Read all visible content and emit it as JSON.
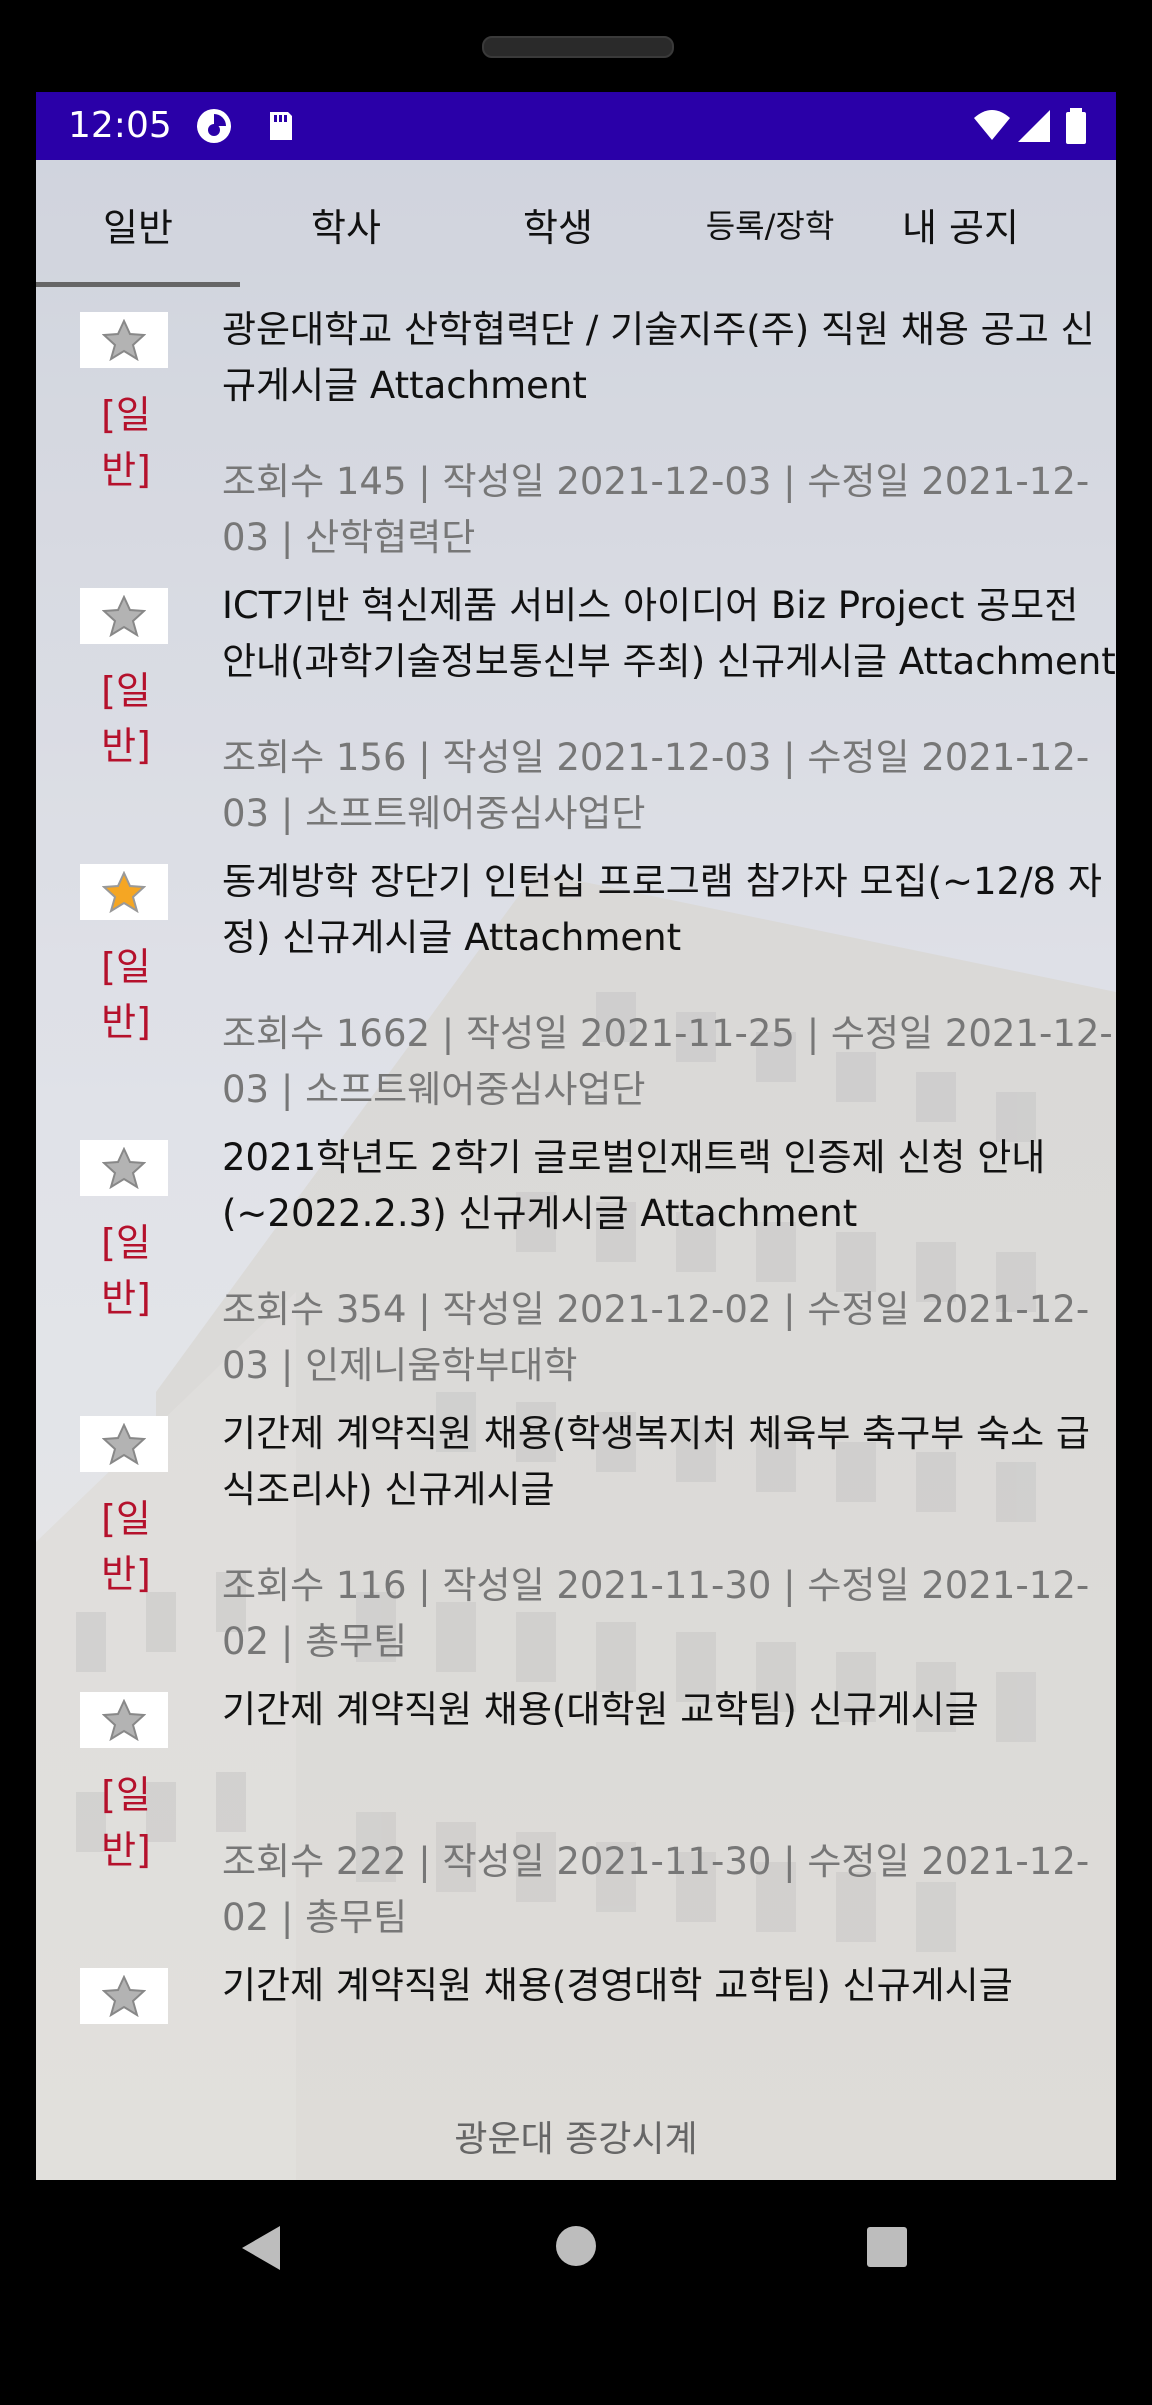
{
  "status": {
    "time": "12:05",
    "icons": [
      "data-saver-icon",
      "sd-card-icon",
      "wifi-icon",
      "signal-icon",
      "battery-icon"
    ]
  },
  "tabs": [
    {
      "label": "일반",
      "selected": true
    },
    {
      "label": "학사",
      "selected": false
    },
    {
      "label": "학생",
      "selected": false
    },
    {
      "label": "등록/장학",
      "selected": false
    },
    {
      "label": "내 공지",
      "selected": false
    }
  ],
  "items": [
    {
      "category": "[일반]",
      "starred": false,
      "title": " 광운대학교 산학협력단 / 기술지주(주) 직원 채용 공고 신규게시글 Attachment",
      "meta": "조회수 145 | 작성일 2021-12-03 | 수정일 2021-12-03 | 산학협력단"
    },
    {
      "category": "[일반]",
      "starred": false,
      "title": " ICT기반 혁신제품 서비스 아이디어 Biz Project 공모전 안내(과학기술정보통신부 주최) 신규게시글 Attachment",
      "meta": "조회수 156 | 작성일 2021-12-03 | 수정일 2021-12-03 | 소프트웨어중심사업단"
    },
    {
      "category": "[일반]",
      "starred": true,
      "title": " 동계방학 장단기 인턴십 프로그램 참가자 모집(~12/8 자정) 신규게시글 Attachment",
      "meta": "조회수 1662 | 작성일 2021-11-25 | 수정일 2021-12-03 | 소프트웨어중심사업단"
    },
    {
      "category": "[일반]",
      "starred": false,
      "title": " 2021학년도 2학기 글로벌인재트랙 인증제 신청 안내(~2022.2.3) 신규게시글 Attachment",
      "meta": "조회수 354 | 작성일 2021-12-02 | 수정일 2021-12-03 | 인제니움학부대학"
    },
    {
      "category": "[일반]",
      "starred": false,
      "title": " 기간제 계약직원 채용(학생복지처 체육부 축구부 숙소 급식조리사) 신규게시글",
      "meta": "조회수 116 | 작성일 2021-11-30 | 수정일 2021-12-02 | 총무팀"
    },
    {
      "category": "[일반]",
      "starred": false,
      "title": " 기간제 계약직원 채용(대학원 교학팀) 신규게시글",
      "meta": "조회수 222 | 작성일 2021-11-30 | 수정일 2021-12-02 | 총무팀"
    },
    {
      "category": "",
      "starred": false,
      "title": " 기간제 계약직원 채용(경영대학 교학팀) 신규게시글",
      "meta": ""
    }
  ],
  "footer": "광운대 종강시계",
  "colors": {
    "statusbar": "#2a00a8",
    "category": "#b5112c",
    "star_on": "#f5a623"
  },
  "nav": {
    "back": "back-icon",
    "home": "home-icon",
    "recents": "recents-icon"
  }
}
